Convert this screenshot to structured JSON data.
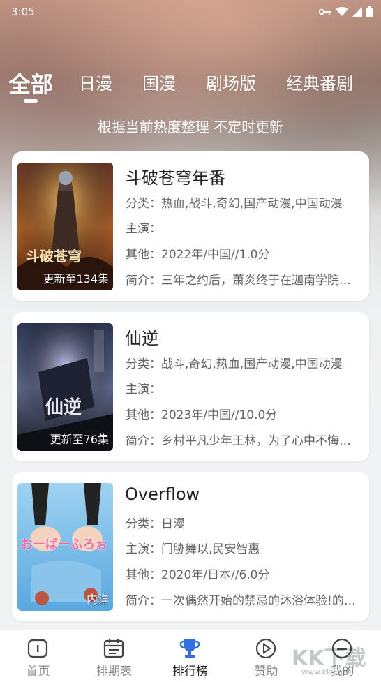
{
  "status_bar": {
    "time": "3:05"
  },
  "tabs": [
    {
      "label": "全部",
      "active": true
    },
    {
      "label": "日漫"
    },
    {
      "label": "国漫"
    },
    {
      "label": "剧场版"
    },
    {
      "label": "经典番剧"
    }
  ],
  "subtitle": "根据当前热度整理 不定时更新",
  "items": [
    {
      "title": "斗破苍穹年番",
      "badge": "更新至134集",
      "category": "分类：热血,战斗,奇幻,国产动漫,中国动漫",
      "cast": "主演：",
      "other": "其他：2022年/中国//1.0分",
      "intro": "简介：三年之约后，萧炎终于在迦南学院见到了",
      "cover_title": "斗破苍穹"
    },
    {
      "title": "仙逆",
      "badge": "更新至76集",
      "category": "分类：战斗,奇幻,热血,国产动漫,中国动漫",
      "cast": "主演：",
      "other": "其他：2023年/中国//10.0分",
      "intro": "简介：乡村平凡少年王林，为了心中不悔的执念",
      "cover_title": "仙逆"
    },
    {
      "title": "Overflow",
      "badge": "内详",
      "category": "分类：日漫",
      "cast": "主演：门胁舞以,民安智惠",
      "other": "其他：2020年/日本//6.0分",
      "intro": "简介：一次偶然开始的禁忌的沐浴体验!的故事",
      "cover_title": "おーばーふろぉ"
    }
  ],
  "bottom_nav": [
    {
      "label": "首页",
      "icon": "home-icon"
    },
    {
      "label": "排期表",
      "icon": "calendar-icon"
    },
    {
      "label": "排行榜",
      "icon": "trophy-icon",
      "active": true
    },
    {
      "label": "赞助",
      "icon": "play-circle-icon"
    },
    {
      "label": "我的",
      "icon": "profile-icon"
    }
  ],
  "watermark": {
    "brand": "KK下载",
    "url": "www.kkx.net"
  },
  "colors": {
    "accent": "#2f6fdf",
    "card_bg": "#ffffff",
    "page_bg": "#f1f2f4"
  }
}
